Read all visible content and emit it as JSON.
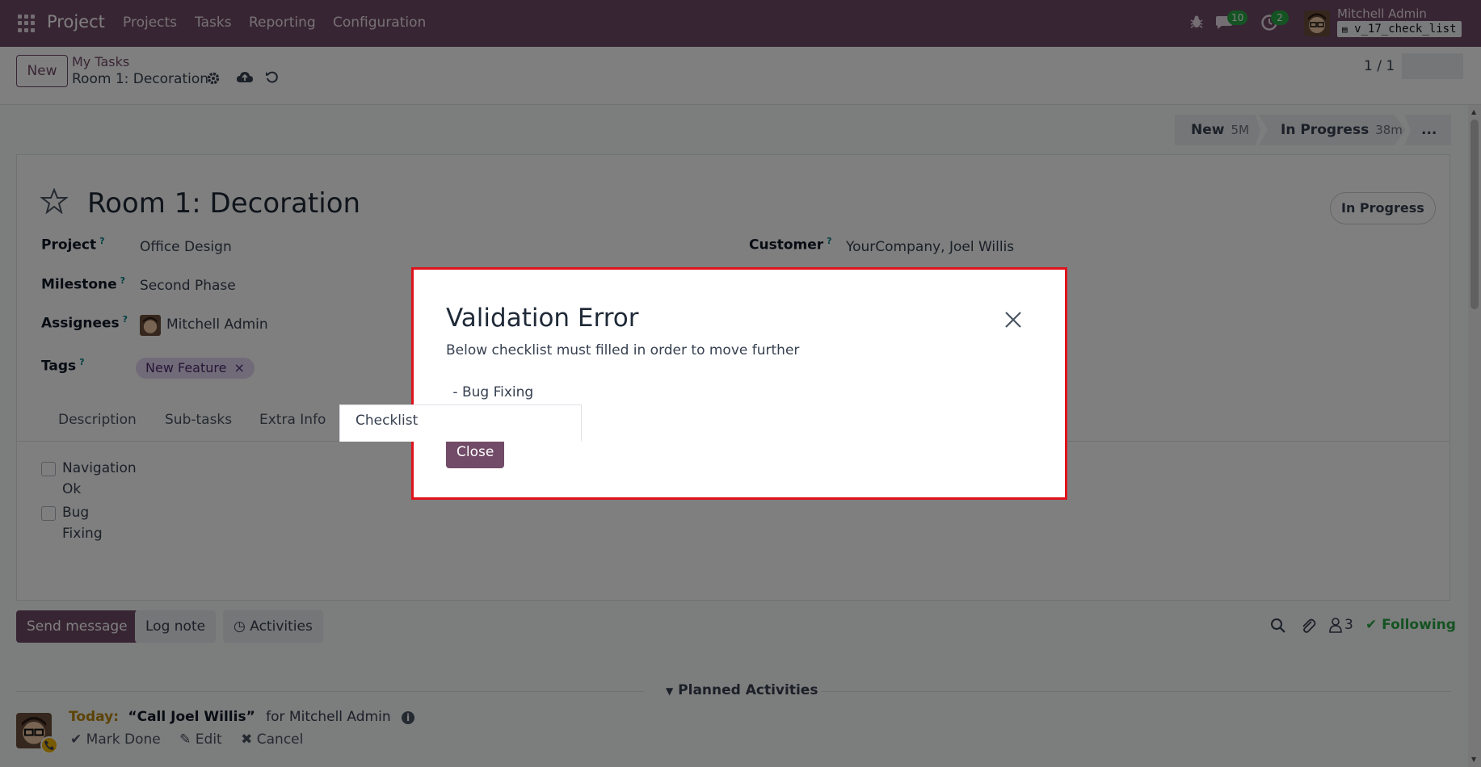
{
  "navbar": {
    "app_name": "Project",
    "menu": [
      "Projects",
      "Tasks",
      "Reporting",
      "Configuration"
    ],
    "messages_count": "10",
    "activities_count": "2",
    "user_name": "Mitchell Admin",
    "database": "v_17_check_list"
  },
  "control_panel": {
    "new_label": "New",
    "breadcrumb_parent": "My Tasks",
    "breadcrumb_current": "Room 1: Decoration",
    "pager_value": "1 / 1"
  },
  "statusbar": {
    "stages": [
      {
        "label": "New",
        "duration": "5M"
      },
      {
        "label": "In Progress",
        "duration": "38m"
      }
    ],
    "more_label": "..."
  },
  "task": {
    "title": "Room 1: Decoration",
    "status": "In Progress",
    "project_label": "Project",
    "project_value": "Office Design",
    "milestone_label": "Milestone",
    "milestone_value": "Second Phase",
    "assignees_label": "Assignees",
    "assignees_value": "Mitchell Admin",
    "tags_label": "Tags",
    "tag": "New Feature",
    "tag_remove": "×",
    "customer_label": "Customer",
    "customer_value": "YourCompany, Joel Willis",
    "help_mark": "?"
  },
  "tabs": [
    "Description",
    "Sub-tasks",
    "Extra Info",
    "Checklist"
  ],
  "checklist": [
    {
      "line1": "Navigation",
      "line2": "Ok"
    },
    {
      "line1": "Bug",
      "line2": "Fixing"
    }
  ],
  "chatter": {
    "send_message": "Send message",
    "log_note": "Log note",
    "activities": "Activities",
    "followers_count": "3",
    "following": "Following",
    "planned_activities": "Planned Activities",
    "activity": {
      "due": "Today:",
      "summary": "“Call Joel Willis”",
      "for": "for Mitchell Admin",
      "mark_done": "Mark Done",
      "edit": "Edit",
      "cancel": "Cancel"
    }
  },
  "modal": {
    "title": "Validation Error",
    "message": "Below checklist must filled in order to move further",
    "item": " - Bug Fixing",
    "close_label": "Close"
  },
  "colors": {
    "brand": "#714b67",
    "modal_border": "#e0131d",
    "success": "#28a745"
  }
}
